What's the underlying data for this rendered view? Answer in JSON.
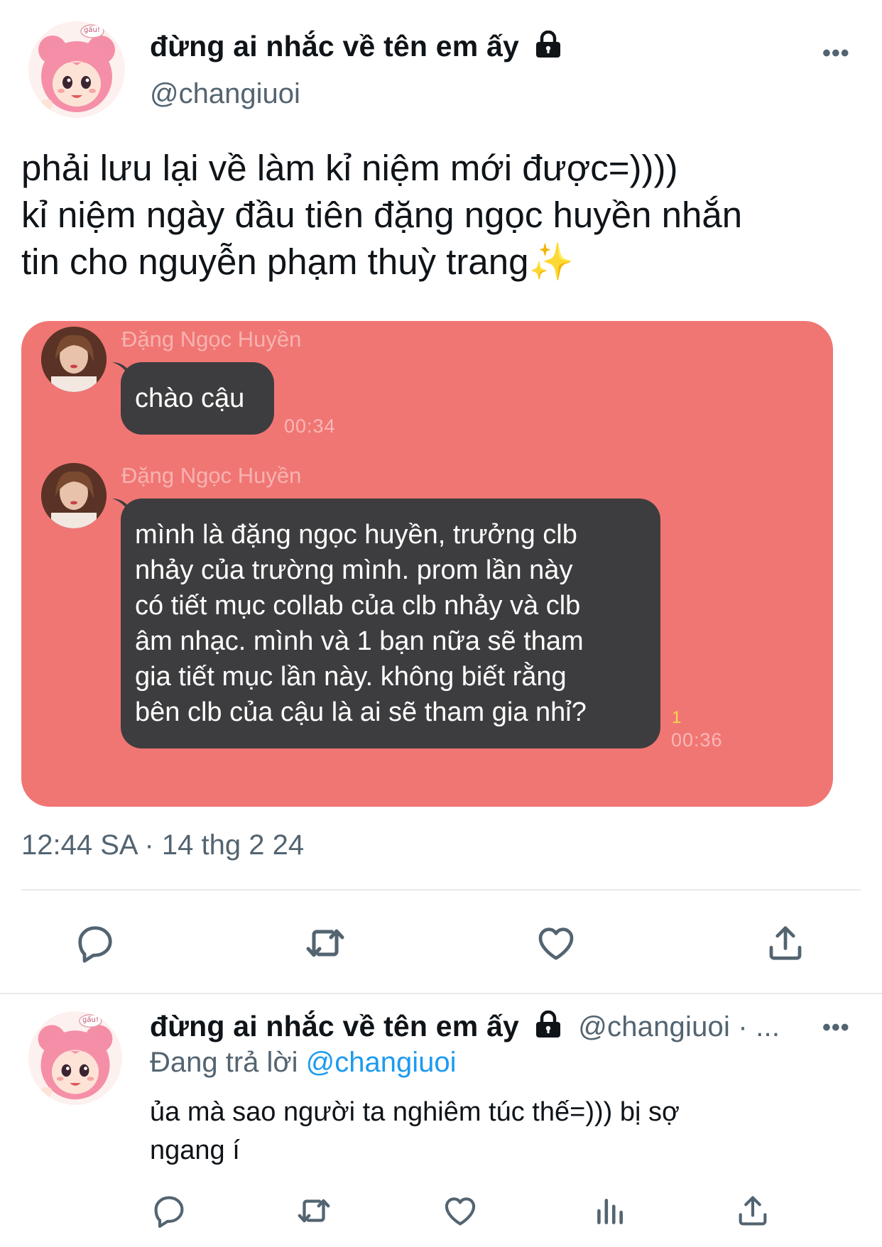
{
  "main_tweet": {
    "display_name": "đừng ai nhắc về tên em ấy",
    "handle": "@changiuoi",
    "more": "•••",
    "avatar_badge": "gấu!",
    "text": "phải lưu lại về làm kỉ niệm mới được=))))\nkỉ niệm ngày đầu tiên đặng ngọc huyền nhắn\ntin cho nguyễn phạm thuỳ trang",
    "sparkles": "✨",
    "timestamp": "12:44 SA · 14 thg 2 24"
  },
  "chat": {
    "messages": [
      {
        "sender": "Đặng Ngọc Huyền",
        "text": "chào cậu",
        "time": "00:34"
      },
      {
        "sender": "Đặng Ngọc Huyền",
        "text": "mình là đặng ngọc huyền, trưởng clb\nnhảy của trường mình. prom lần này\ncó tiết mục collab của clb nhảy và clb\nâm nhạc. mình và 1 bạn nữa sẽ tham\ngia tiết mục lần này. không biết rằng\nbên clb của cậu là ai sẽ tham gia nhỉ?",
        "time": "00:36",
        "unread": "1"
      }
    ]
  },
  "reply_tweet": {
    "display_name": "đừng ai nhắc về tên em ấy",
    "handle": "@changiuoi · ...",
    "more": "•••",
    "avatar_badge": "gấu!",
    "replying_prefix": "Đang trả lời",
    "replying_to": "@changiuoi",
    "text": "ủa mà sao người ta nghiêm túc thế=))) bị sợ\nngang í"
  },
  "icons": {
    "reply": "reply-icon",
    "retweet": "retweet-icon",
    "like": "like-icon",
    "share": "share-icon",
    "analytics": "analytics-icon",
    "lock": "lock-icon"
  },
  "colors": {
    "chat_background": "#f07674",
    "bubble": "#3d3d3f",
    "link": "#1d9bf0",
    "secondary_text": "#536471"
  }
}
